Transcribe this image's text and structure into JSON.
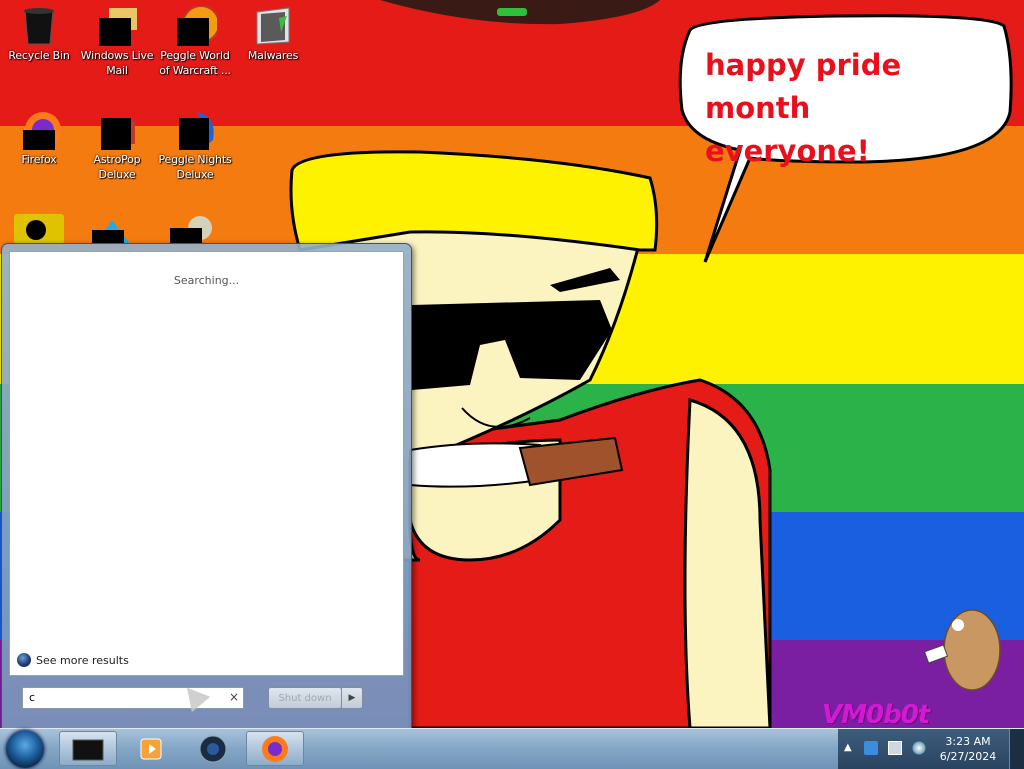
{
  "desktop": {
    "icons": [
      {
        "label": "Recycle Bin"
      },
      {
        "label": "Windows Live Mail"
      },
      {
        "label": "Peggle World of Warcraft ..."
      },
      {
        "label": "Malwares"
      },
      {
        "label": "Firefox"
      },
      {
        "label": "AstroPop Deluxe"
      },
      {
        "label": "Peggle Nights Deluxe"
      }
    ]
  },
  "wallpaper": {
    "speech_bubble": "happy pride month\neveryone!",
    "watermark": "VM0b0t",
    "stripe_colors": [
      "#e41b17",
      "#f47b10",
      "#fff200",
      "#2bb34a",
      "#1a5fe0",
      "#7b1fa2"
    ]
  },
  "start_menu": {
    "status_text": "Searching...",
    "see_more_label": "See more results",
    "search_value": "c",
    "clear_glyph": "×",
    "shutdown_label": "Shut down",
    "shutdown_arrow": "▶"
  },
  "taskbar": {
    "time": "3:23 AM",
    "date": "6/27/2024",
    "tray_arrow": "▲"
  }
}
